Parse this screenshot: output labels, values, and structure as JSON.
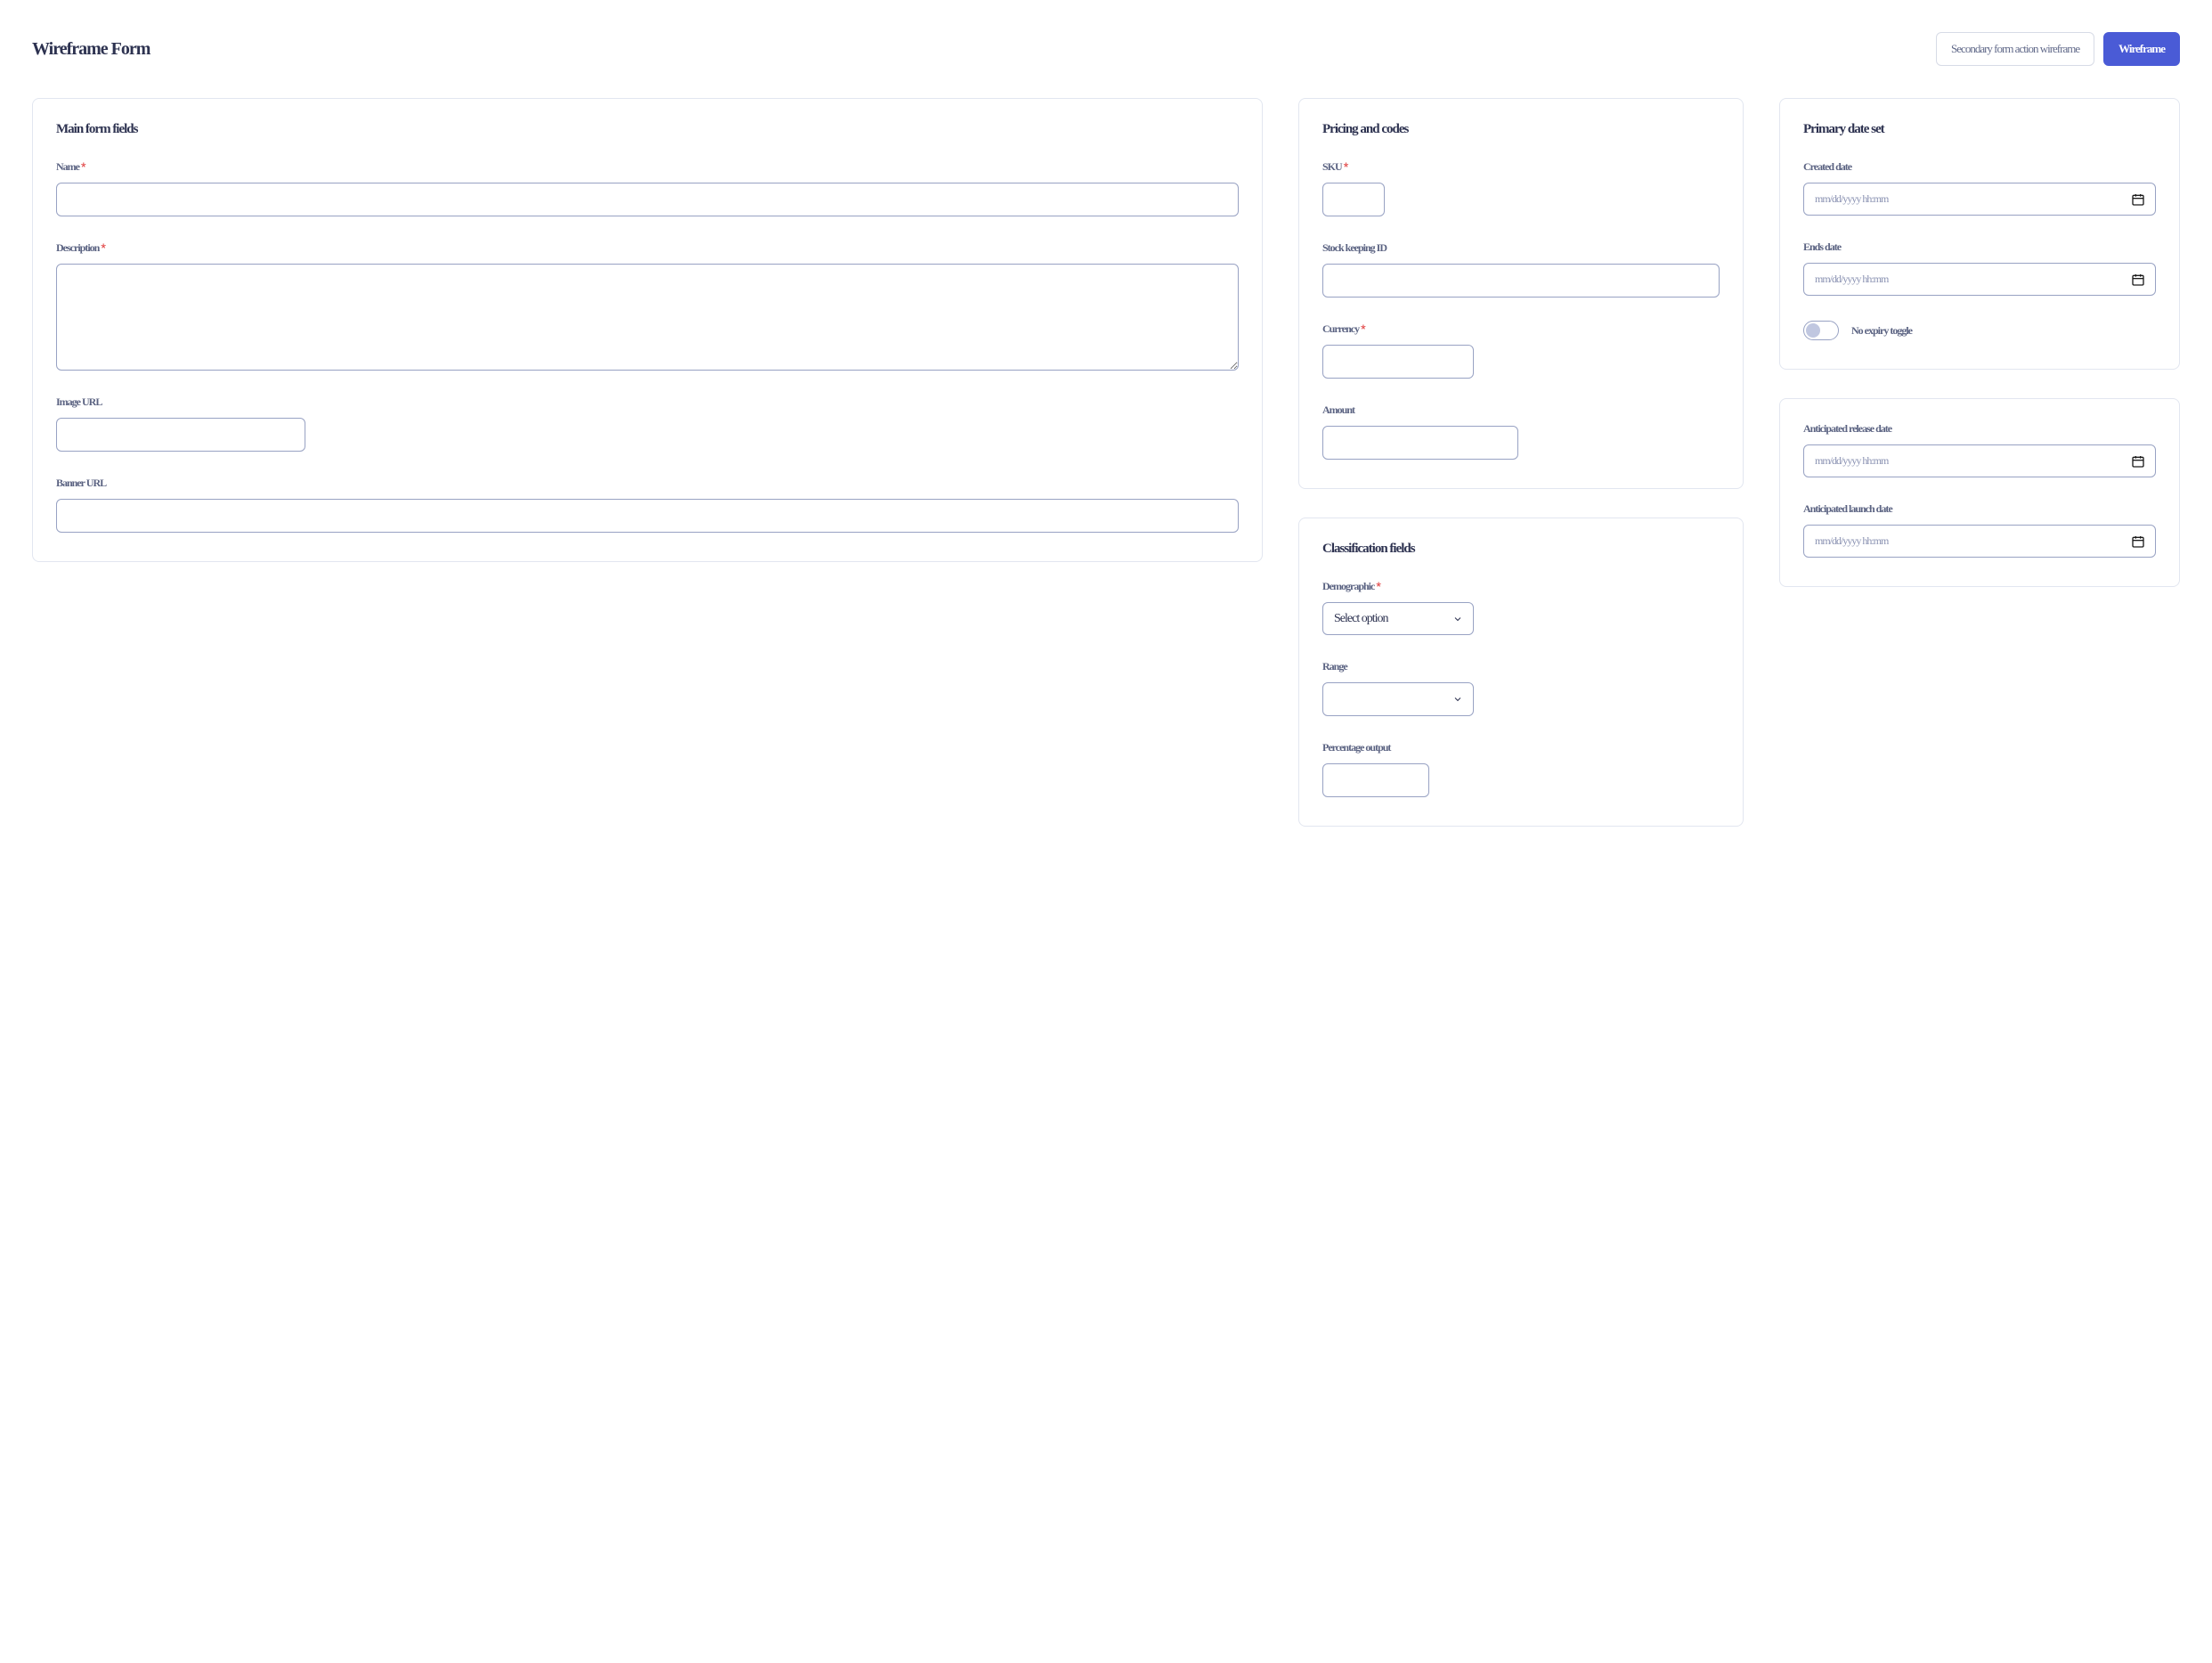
{
  "header": {
    "title": "Wireframe Form",
    "secondary_action": "Secondary form action wireframe",
    "primary_action": "Wireframe"
  },
  "card_main": {
    "title": "Main form fields",
    "name_label": "Name",
    "description_label": "Description",
    "image_url_label": "Image URL",
    "banner_url_label": "Banner URL"
  },
  "card_pricing": {
    "title": "Pricing and codes",
    "sku_label": "SKU",
    "stock_label": "Stock keeping ID",
    "currency_label": "Currency",
    "amount_label": "Amount"
  },
  "card_audience": {
    "title": "Classification fields",
    "demographic_label": "Demographic",
    "demographic_value": "Select option",
    "range_label": "Range",
    "percentage_label": "Percentage output"
  },
  "card_dates": {
    "title": "Primary date set",
    "created_label": "Created date",
    "ends_label": "Ends date",
    "date_placeholder": "mm/dd/yyyy hh:mm",
    "toggle_label": "No expiry toggle"
  },
  "card_dates2": {
    "release_label": "Anticipated release date",
    "launch_label": "Anticipated launch date",
    "date_placeholder": "mm/dd/yyyy hh:mm"
  }
}
